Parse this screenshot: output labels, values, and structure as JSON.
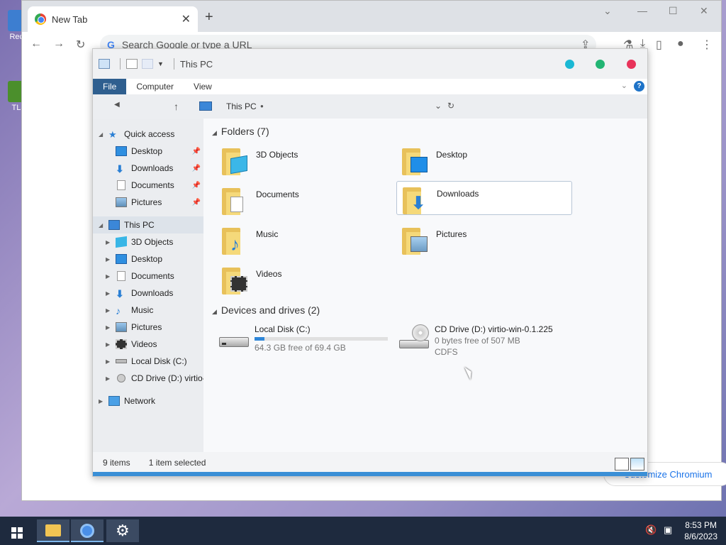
{
  "desktop": {
    "icons": [
      {
        "label": "Recy"
      },
      {
        "label": "TLa"
      }
    ]
  },
  "chrome": {
    "tab_title": "New Tab",
    "omnibox_placeholder": "Search Google or type a URL",
    "customize_label": "Customize Chromium"
  },
  "explorer": {
    "title": "This PC",
    "ribbon_tabs": [
      "File",
      "Computer",
      "View"
    ],
    "address_path": "This PC",
    "sidebar": {
      "quick_access": "Quick access",
      "quick_items": [
        "Desktop",
        "Downloads",
        "Documents",
        "Pictures"
      ],
      "this_pc": "This PC",
      "pc_items": [
        "3D Objects",
        "Desktop",
        "Documents",
        "Downloads",
        "Music",
        "Pictures",
        "Videos",
        "Local Disk (C:)",
        "CD Drive (D:) virtio-"
      ],
      "network": "Network"
    },
    "folders_header": "Folders (7)",
    "folders": [
      "3D Objects",
      "Desktop",
      "Documents",
      "Downloads",
      "Music",
      "Pictures",
      "Videos"
    ],
    "devices_header": "Devices and drives (2)",
    "drives": [
      {
        "name": "Local Disk (C:)",
        "free": "64.3 GB free of 69.4 GB",
        "used_fraction": 0.073
      },
      {
        "name": "CD Drive (D:) virtio-win-0.1.225",
        "free": "0 bytes free of 507 MB",
        "fs": "CDFS"
      }
    ],
    "status_items": "9 items",
    "status_selected": "1 item selected"
  },
  "taskbar": {
    "time": "8:53 PM",
    "date": "8/6/2023"
  },
  "colors": {
    "accent": "#1e73c8",
    "dot_cyan": "#1ab8d4",
    "dot_green": "#22b573",
    "dot_red": "#e8335a"
  }
}
